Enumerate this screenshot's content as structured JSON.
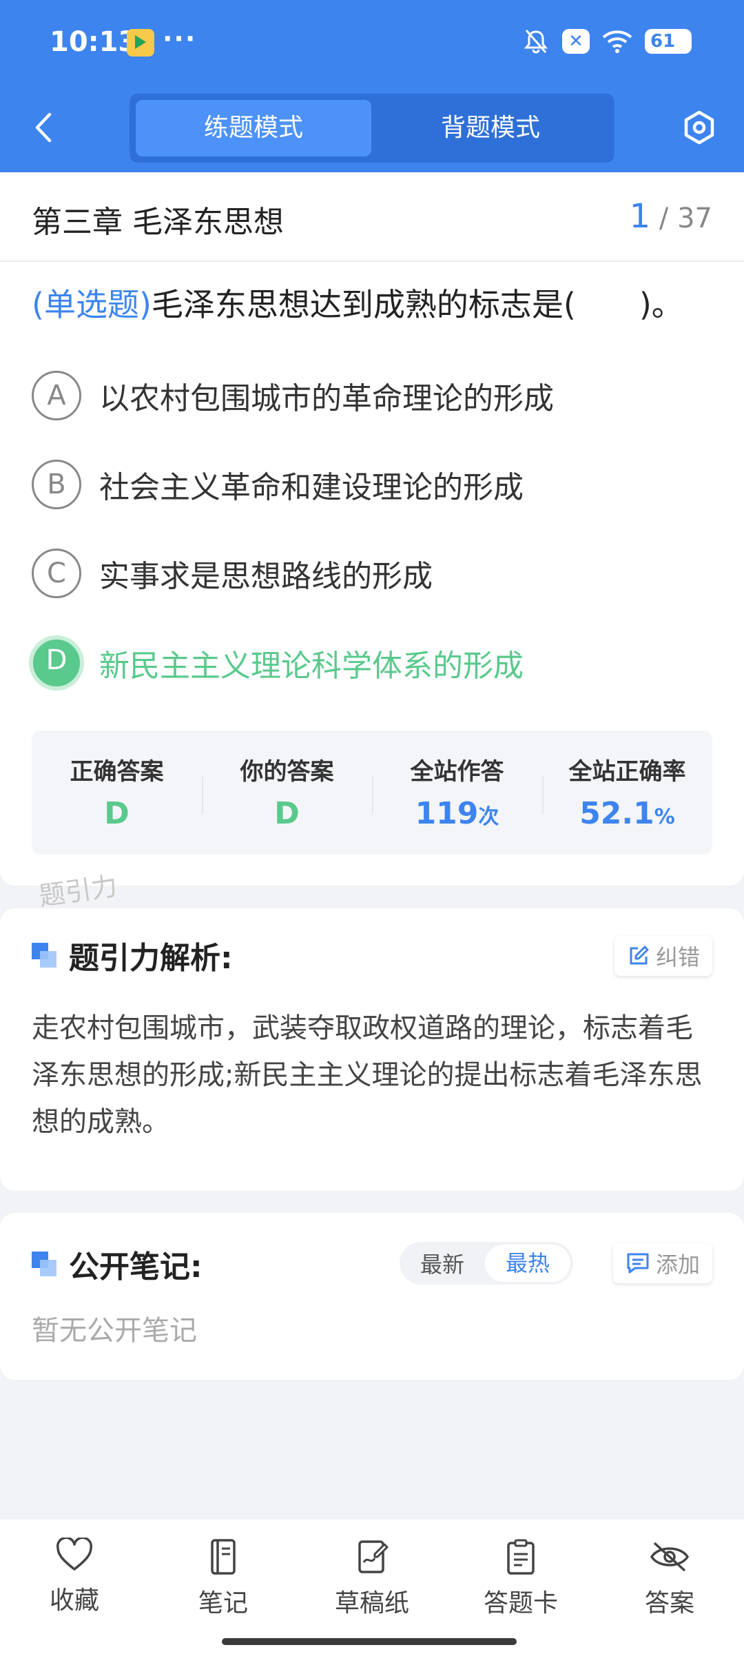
{
  "status_bar": {
    "time": "10:13",
    "more": "···",
    "battery": "61"
  },
  "header": {
    "tabs": [
      {
        "label": "练题模式",
        "active": true
      },
      {
        "label": "背题模式",
        "active": false
      }
    ],
    "accent": "#3d84ef"
  },
  "question": {
    "chapter": "第三章 毛泽东思想",
    "current": "1",
    "total": "/ 37",
    "type": "(单选题)",
    "stem": "毛泽东思想达到成熟的标志是(　　)。",
    "options": [
      {
        "letter": "A",
        "text": "以农村包围城市的革命理论的形成"
      },
      {
        "letter": "B",
        "text": "社会主义革命和建设理论的形成"
      },
      {
        "letter": "C",
        "text": "实事求是思想路线的形成"
      },
      {
        "letter": "D",
        "text": "新民主主义理论科学体系的形成",
        "correct": true
      }
    ]
  },
  "stats": {
    "correct_label": "正确答案",
    "correct_value": "D",
    "yours_label": "你的答案",
    "yours_value": "D",
    "answers_label": "全站作答",
    "answers_value": "119",
    "answers_unit": "次",
    "rate_label": "全站正确率",
    "rate_value": "52.1",
    "rate_unit": "%"
  },
  "watermark": "题引力",
  "analysis": {
    "title": "题引力解析:",
    "report_label": "纠错",
    "text": "走农村包围城市，武装夺取政权道路的理论，标志着毛泽东思想的形成;新民主主义理论的提出标志着毛泽东思想的成熟。"
  },
  "notes": {
    "title": "公开笔记:",
    "sort_latest": "最新",
    "sort_hot": "最热",
    "add_label": "添加",
    "empty": "暂无公开笔记"
  },
  "bottom_nav": [
    {
      "label": "收藏",
      "icon": "heart-icon"
    },
    {
      "label": "笔记",
      "icon": "notebook-icon"
    },
    {
      "label": "草稿纸",
      "icon": "draft-icon"
    },
    {
      "label": "答题卡",
      "icon": "clipboard-icon"
    },
    {
      "label": "答案",
      "icon": "eye-off-icon"
    }
  ]
}
